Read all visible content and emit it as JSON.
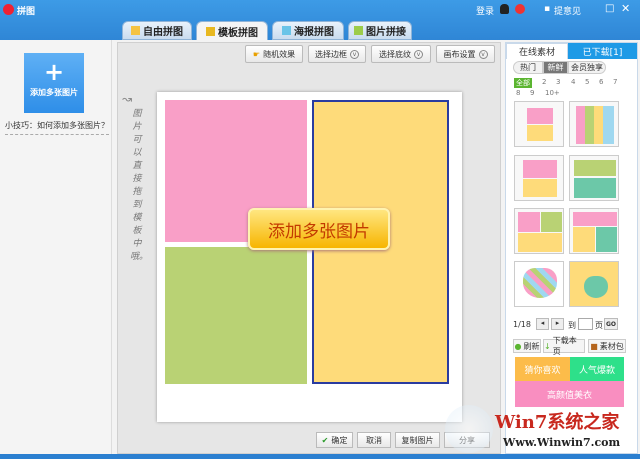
{
  "app": {
    "title": "拼图",
    "login": "登录",
    "feedback": "提意见"
  },
  "tabs": [
    {
      "label": "自由拼图"
    },
    {
      "label": "模板拼图"
    },
    {
      "label": "海报拼图"
    },
    {
      "label": "图片拼接"
    }
  ],
  "left": {
    "add_label": "添加多张图片",
    "tip": "小技巧：如何添加多张图片？"
  },
  "toolbar": {
    "random": "随机效果",
    "border": "选择边框",
    "texture": "选择底纹",
    "canvas": "画布设置"
  },
  "canvas": {
    "hint": "图片可以直接拖到模板中哦。",
    "add_button": "添加多张图片",
    "colors": {
      "pink": "#f99fc7",
      "green": "#b9d274",
      "yellow": "#fedb7a"
    }
  },
  "right": {
    "tab_online": "在线素材",
    "tab_downloaded": "已下载[1]",
    "filters": [
      "热门",
      "新鲜",
      "会员独享"
    ],
    "pages": [
      "全部",
      "2",
      "3",
      "4",
      "5",
      "6",
      "7",
      "8",
      "9",
      "10+"
    ],
    "page_info": "1/18",
    "goto": "到",
    "page_unit": "页",
    "go": "GO",
    "refresh": "刷新",
    "download_page": "下载本页",
    "package": "素材包",
    "promo": [
      "猜你喜欢",
      "人气爆款",
      "高颜值美衣"
    ]
  },
  "bottom": {
    "ok": "确定",
    "cancel": "取消",
    "copy": "复制图片",
    "share": "分享"
  },
  "watermark": {
    "brand": "Win7系统之家",
    "url": "Www.Winwin7.com"
  }
}
